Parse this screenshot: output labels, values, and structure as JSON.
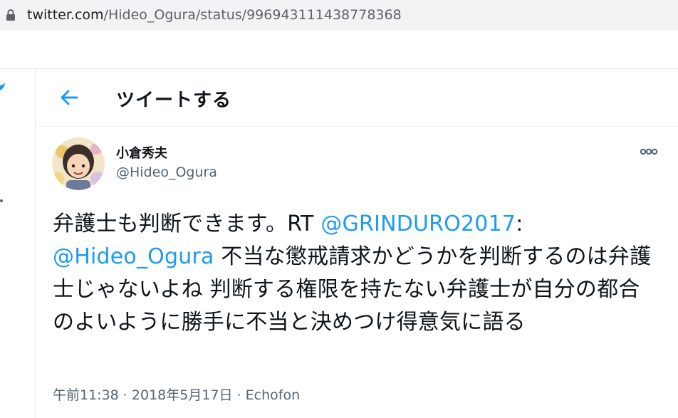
{
  "browser": {
    "url_host": "twitter.com",
    "url_path": "/Hideo_Ogura/status/996943111438778368"
  },
  "header": {
    "title": "ツイートする"
  },
  "tweet": {
    "author_name": "小倉秀夫",
    "author_handle": "@Hideo_Ogura",
    "text": {
      "part1": "弁護士も判断できます。RT ",
      "mention1": "@GRINDURO2017",
      "part2": ": ",
      "mention2": "@Hideo_Ogura",
      "part3": " 不当な懲戒請求かどうかを判断するのは弁護士じゃないよね 判断する権限を持たない弁護士が自分の都合のよいように勝手に不当と決めつけ得意気に語る"
    },
    "time": "午前11:38",
    "date": "2018年5月17日",
    "source": "Echofon",
    "separator": " · "
  },
  "colors": {
    "accent": "#1d9bf0",
    "secondary_text": "#536471",
    "divider": "#eff3f4"
  },
  "icons": [
    "lock-icon",
    "back-arrow-icon",
    "more-options-icon",
    "twitter-bird-icon"
  ]
}
